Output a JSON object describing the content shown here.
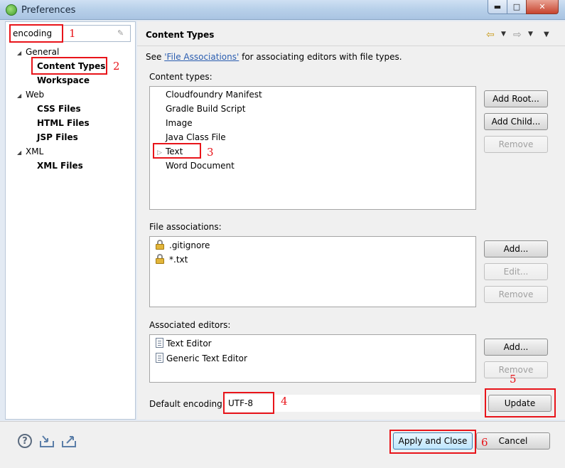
{
  "window": {
    "title": "Preferences",
    "controls": {
      "minimize": "▬",
      "maximize": "□",
      "close": "✕"
    }
  },
  "filter": {
    "value": "encoding"
  },
  "tree": {
    "items": [
      {
        "label": "General",
        "level": 0,
        "expanded": true
      },
      {
        "label": "Content Types",
        "level": 1,
        "selected": true
      },
      {
        "label": "Workspace",
        "level": 1
      },
      {
        "label": "Web",
        "level": 0,
        "expanded": true
      },
      {
        "label": "CSS Files",
        "level": 1
      },
      {
        "label": "HTML Files",
        "level": 1
      },
      {
        "label": "JSP Files",
        "level": 1
      },
      {
        "label": "XML",
        "level": 0,
        "expanded": true
      },
      {
        "label": "XML Files",
        "level": 1
      }
    ]
  },
  "page": {
    "title": "Content Types",
    "description_prefix": "See ",
    "description_link": "'File Associations'",
    "description_suffix": " for associating editors with file types.",
    "content_types_label": "Content types:",
    "content_types": [
      "Cloudfoundry Manifest",
      "Gradle Build Script",
      "Image",
      "Java Class File",
      "Text",
      "Word Document"
    ],
    "content_type_buttons": {
      "add_root": "Add Root...",
      "add_child": "Add Child...",
      "remove": "Remove"
    },
    "file_associations_label": "File associations:",
    "file_associations": [
      ".gitignore",
      "*.txt"
    ],
    "file_assoc_buttons": {
      "add": "Add...",
      "edit": "Edit...",
      "remove": "Remove"
    },
    "associated_editors_label": "Associated editors:",
    "associated_editors": [
      "Text Editor",
      "Generic Text Editor"
    ],
    "editor_buttons": {
      "add": "Add...",
      "remove": "Remove"
    },
    "default_encoding_label": "Default encoding:",
    "default_encoding_value": "UTF-8",
    "update_button": "Update"
  },
  "footer": {
    "apply_close": "Apply and Close",
    "cancel": "Cancel"
  },
  "annotations": [
    "1",
    "2",
    "3",
    "4",
    "5",
    "6"
  ],
  "colors": {
    "annotation": "#e8141a",
    "link": "#2a5db0"
  }
}
